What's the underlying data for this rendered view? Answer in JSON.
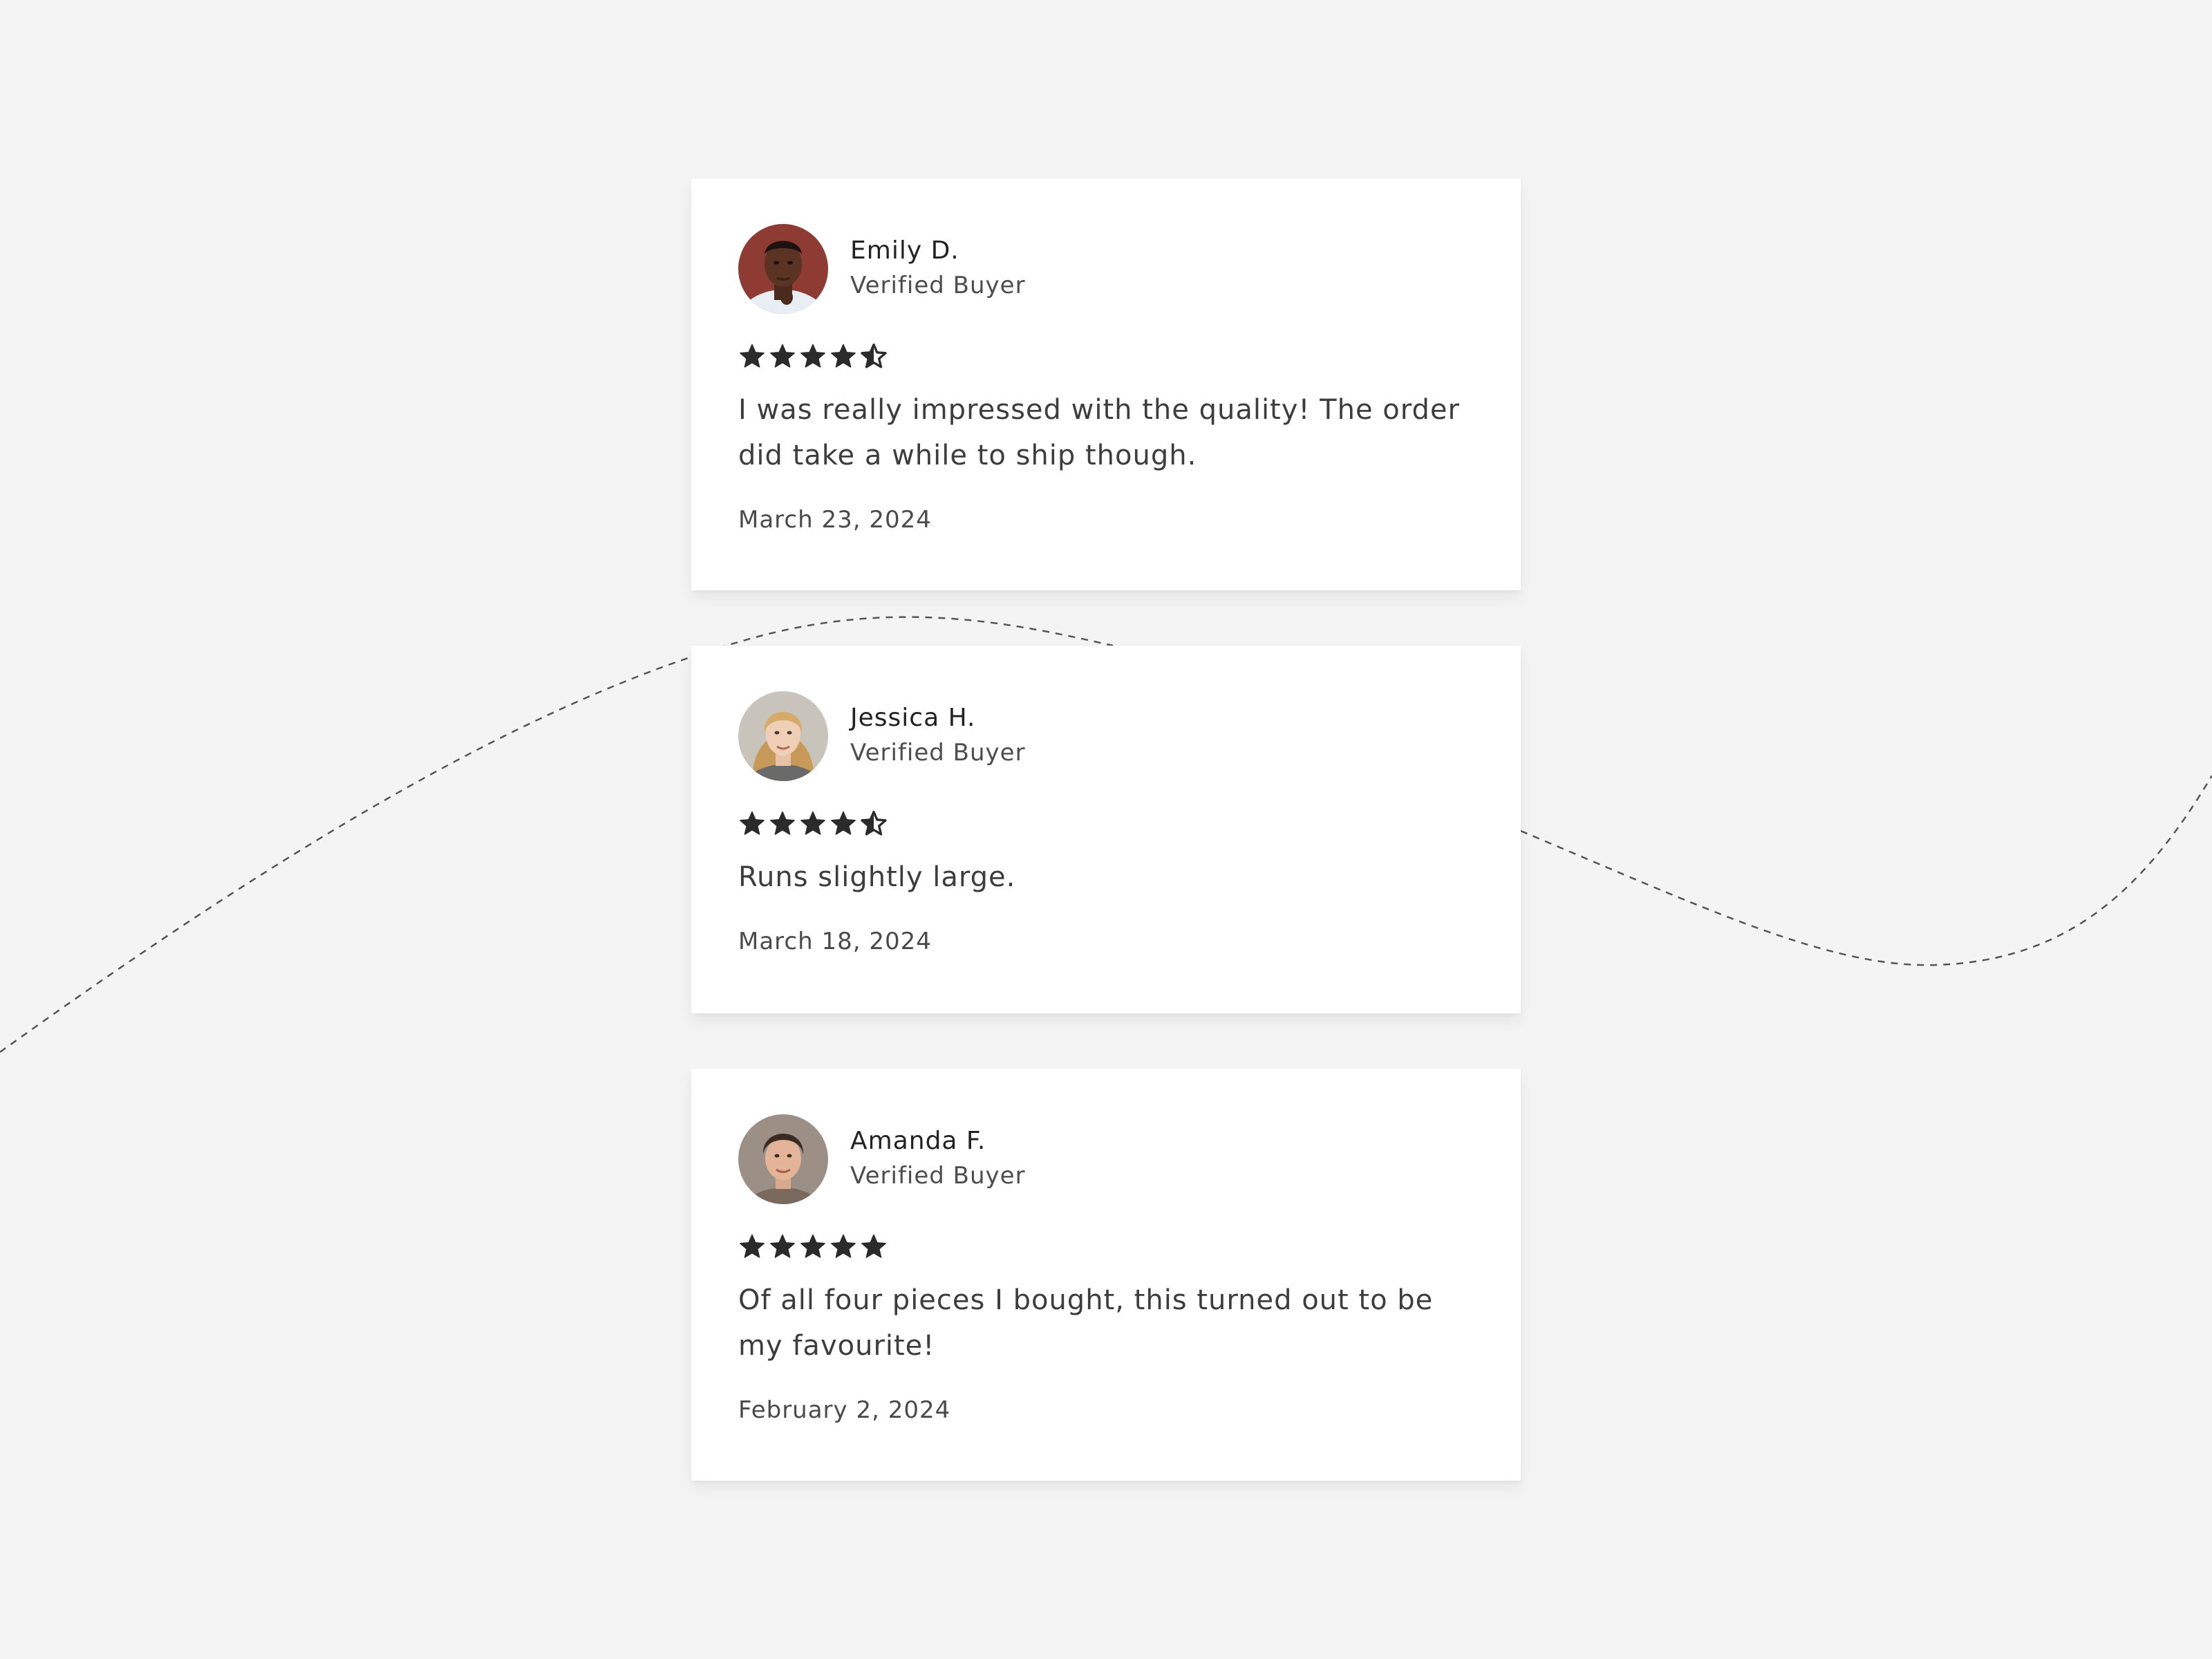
{
  "colors": {
    "background": "#f4f4f4",
    "card": "#ffffff",
    "star": "#2b2b2b",
    "text": "#3d3d3d",
    "curve": "#555555"
  },
  "reviews": [
    {
      "name": "Emily D.",
      "status": "Verified Buyer",
      "rating": 4.5,
      "text": "I was really impressed with the quality! The order did take a while to ship though.",
      "date": "March 23, 2024",
      "avatar_icon": "avatar-photo"
    },
    {
      "name": "Jessica H.",
      "status": "Verified Buyer",
      "rating": 4.5,
      "text": "Runs slightly large.",
      "date": "March 18, 2024",
      "avatar_icon": "avatar-photo"
    },
    {
      "name": "Amanda F.",
      "status": "Verified Buyer",
      "rating": 5,
      "text": "Of all four pieces I bought, this turned out to be my favourite!",
      "date": "February 2, 2024",
      "avatar_icon": "avatar-photo"
    }
  ]
}
